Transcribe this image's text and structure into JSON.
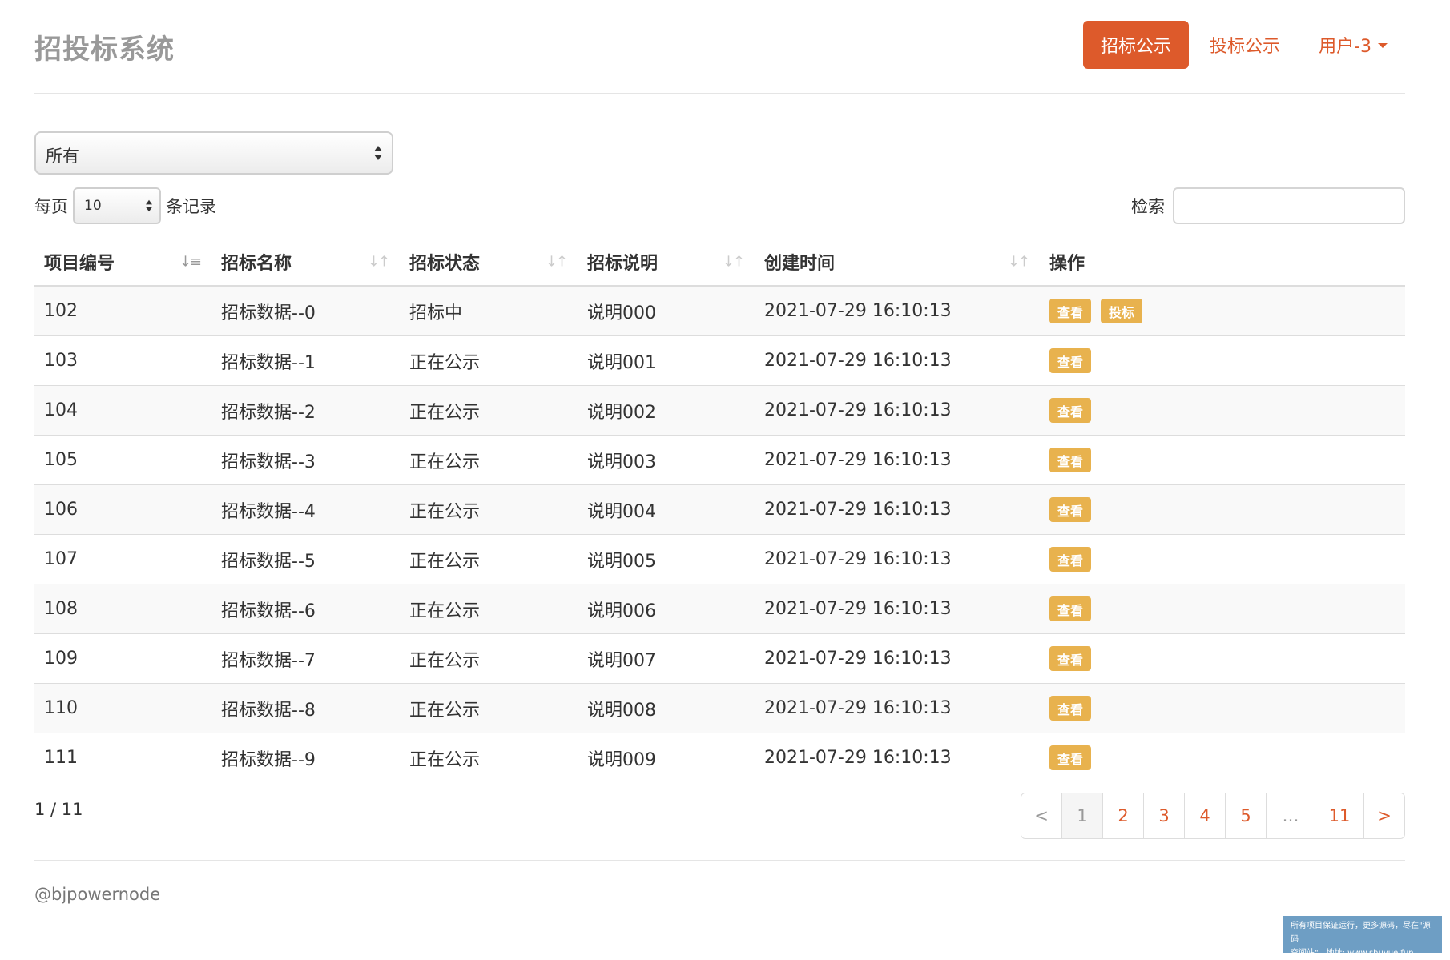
{
  "header": {
    "brand": "招投标系统",
    "nav": [
      {
        "label": "招标公示",
        "active": true
      },
      {
        "label": "投标公示",
        "active": false
      }
    ],
    "user_menu": "用户-3"
  },
  "filter": {
    "selected": "所有"
  },
  "length_control": {
    "prefix": "每页",
    "value": "10",
    "suffix": "条记录"
  },
  "search": {
    "label": "检索",
    "value": ""
  },
  "table": {
    "columns": [
      "项目编号",
      "招标名称",
      "招标状态",
      "招标说明",
      "创建时间",
      "操作"
    ],
    "sorted_column": "项目编号",
    "rows": [
      {
        "id": "102",
        "name": "招标数据--0",
        "status": "招标中",
        "desc": "说明000",
        "created": "2021-07-29 16:10:13",
        "actions": [
          "查看",
          "投标"
        ]
      },
      {
        "id": "103",
        "name": "招标数据--1",
        "status": "正在公示",
        "desc": "说明001",
        "created": "2021-07-29 16:10:13",
        "actions": [
          "查看"
        ]
      },
      {
        "id": "104",
        "name": "招标数据--2",
        "status": "正在公示",
        "desc": "说明002",
        "created": "2021-07-29 16:10:13",
        "actions": [
          "查看"
        ]
      },
      {
        "id": "105",
        "name": "招标数据--3",
        "status": "正在公示",
        "desc": "说明003",
        "created": "2021-07-29 16:10:13",
        "actions": [
          "查看"
        ]
      },
      {
        "id": "106",
        "name": "招标数据--4",
        "status": "正在公示",
        "desc": "说明004",
        "created": "2021-07-29 16:10:13",
        "actions": [
          "查看"
        ]
      },
      {
        "id": "107",
        "name": "招标数据--5",
        "status": "正在公示",
        "desc": "说明005",
        "created": "2021-07-29 16:10:13",
        "actions": [
          "查看"
        ]
      },
      {
        "id": "108",
        "name": "招标数据--6",
        "status": "正在公示",
        "desc": "说明006",
        "created": "2021-07-29 16:10:13",
        "actions": [
          "查看"
        ]
      },
      {
        "id": "109",
        "name": "招标数据--7",
        "status": "正在公示",
        "desc": "说明007",
        "created": "2021-07-29 16:10:13",
        "actions": [
          "查看"
        ]
      },
      {
        "id": "110",
        "name": "招标数据--8",
        "status": "正在公示",
        "desc": "说明008",
        "created": "2021-07-29 16:10:13",
        "actions": [
          "查看"
        ]
      },
      {
        "id": "111",
        "name": "招标数据--9",
        "status": "正在公示",
        "desc": "说明009",
        "created": "2021-07-29 16:10:13",
        "actions": [
          "查看"
        ]
      }
    ]
  },
  "pagination": {
    "info": "1 / 11",
    "prev": "<",
    "pages": [
      "1",
      "2",
      "3",
      "4",
      "5",
      "…",
      "11"
    ],
    "current": "1",
    "next": ">"
  },
  "footer": {
    "text": "@bjpowernode"
  },
  "watermark": {
    "line1": "所有项目保证运行，更多源码，尽在\"源码",
    "line2": "空间站\"，地址: www.shuyue.fun"
  },
  "colors": {
    "accent": "#dd5a2b",
    "action_button": "#e8b24e",
    "brand_text": "#999999",
    "watermark_bg": "#6e9ec4"
  },
  "icons": {
    "sort_active": "sort-amount-asc-icon",
    "sort_inactive": "sort-both-icon",
    "select_arrows": "select-updown-icon",
    "dropdown_caret": "caret-down-icon"
  }
}
